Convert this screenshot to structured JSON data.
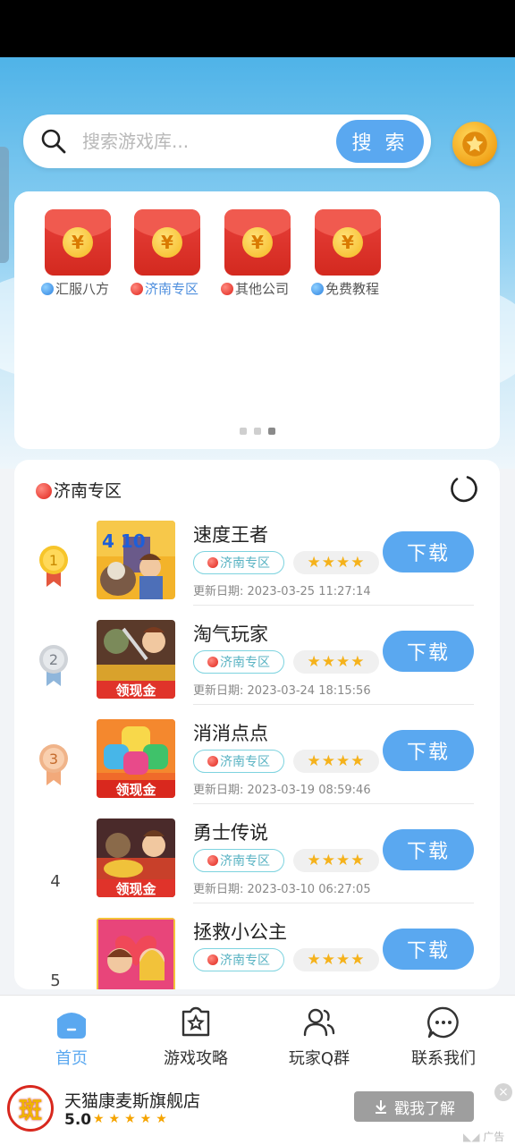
{
  "search": {
    "placeholder": "搜索游戏库...",
    "button_label": "搜 索"
  },
  "quick_links": [
    {
      "label": "汇服八方",
      "dot": "blue",
      "active": false
    },
    {
      "label": "济南专区",
      "dot": "red",
      "active": true
    },
    {
      "label": "其他公司",
      "dot": "red",
      "active": false
    },
    {
      "label": "免费教程",
      "dot": "blue",
      "active": false
    }
  ],
  "redpack_symbol": "¥",
  "carousel": {
    "pages": 3,
    "current": 3
  },
  "list": {
    "title": "济南专区",
    "date_prefix": "更新日期:",
    "download_label": "下载",
    "items": [
      {
        "rank": "1",
        "name": "速度王者",
        "zone": "济南专区",
        "stars": 4,
        "stars_text": "★★★★",
        "date": "2023-03-25 11:27:14"
      },
      {
        "rank": "2",
        "name": "淘气玩家",
        "zone": "济南专区",
        "stars": 4,
        "stars_text": "★★★★",
        "date": "2023-03-24 18:15:56"
      },
      {
        "rank": "3",
        "name": "消消点点",
        "zone": "济南专区",
        "stars": 4,
        "stars_text": "★★★★",
        "date": "2023-03-19 08:59:46"
      },
      {
        "rank": "4",
        "name": "勇士传说",
        "zone": "济南专区",
        "stars": 4,
        "stars_text": "★★★★",
        "date": "2023-03-10 06:27:05"
      },
      {
        "rank": "5",
        "name": "拯救小公主",
        "zone": "济南专区",
        "stars": 4,
        "stars_text": "★★★★",
        "date": ""
      }
    ],
    "icon_texts": {
      "speed": "4 10",
      "cash": "领现金"
    }
  },
  "tabbar": [
    {
      "label": "首页",
      "icon": "home-icon",
      "active": true
    },
    {
      "label": "游戏攻略",
      "icon": "game-guide-icon",
      "active": false
    },
    {
      "label": "玩家Q群",
      "icon": "group-icon",
      "active": false
    },
    {
      "label": "联系我们",
      "icon": "chat-icon",
      "active": false
    }
  ],
  "ad": {
    "logo_char": "斑",
    "store_name": "天猫康麦斯旗舰店",
    "score": "5.0",
    "stars_text": "★★★★★",
    "button_label": "戳我了解",
    "close_symbol": "×",
    "ad_tag": "广告"
  },
  "colors": {
    "accent": "#5aa8f0",
    "zone_tag": "#59b3c3",
    "redpack": "#d3291f",
    "star": "#f5b21b"
  }
}
